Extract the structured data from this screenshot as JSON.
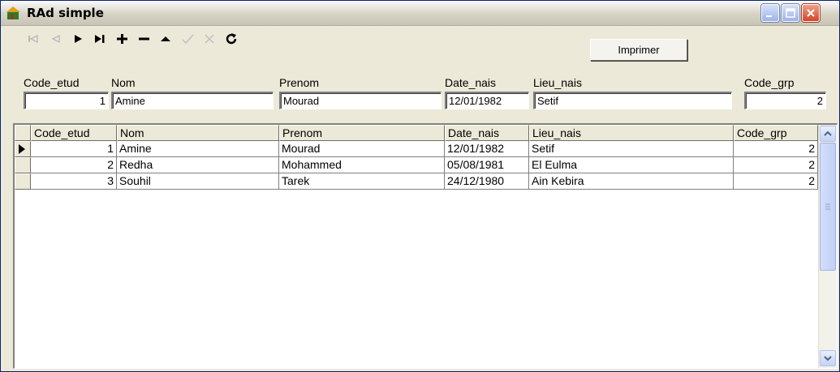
{
  "window": {
    "title": "RAd simple"
  },
  "navigator": {
    "buttons": [
      {
        "name": "first-record-icon",
        "enabled": false
      },
      {
        "name": "prior-record-icon",
        "enabled": false
      },
      {
        "name": "next-record-icon",
        "enabled": true
      },
      {
        "name": "last-record-icon",
        "enabled": true
      },
      {
        "name": "insert-record-icon",
        "enabled": true
      },
      {
        "name": "delete-record-icon",
        "enabled": true
      },
      {
        "name": "edit-record-icon",
        "enabled": true
      },
      {
        "name": "post-record-icon",
        "enabled": false
      },
      {
        "name": "cancel-record-icon",
        "enabled": false
      },
      {
        "name": "refresh-record-icon",
        "enabled": true
      }
    ]
  },
  "print_button": {
    "label": "Imprimer"
  },
  "form": {
    "code_etud": {
      "label": "Code_etud",
      "value": "1"
    },
    "nom": {
      "label": "Nom",
      "value": "Amine"
    },
    "prenom": {
      "label": "Prenom",
      "value": "Mourad"
    },
    "date_nais": {
      "label": "Date_nais",
      "value": "12/01/1982"
    },
    "lieu_nais": {
      "label": "Lieu_nais",
      "value": "Setif"
    },
    "code_grp": {
      "label": "Code_grp",
      "value": "2"
    }
  },
  "grid": {
    "columns": [
      "Code_etud",
      "Nom",
      "Prenom",
      "Date_nais",
      "Lieu_nais",
      "Code_grp"
    ],
    "rows": [
      [
        "1",
        "Amine",
        "Mourad",
        "12/01/1982",
        "Setif",
        "2"
      ],
      [
        "2",
        "Redha",
        "Mohammed",
        "05/08/1981",
        "El Eulma",
        "2"
      ],
      [
        "3",
        "Souhil",
        "Tarek",
        "24/12/1980",
        "Ain Kebira",
        "2"
      ]
    ],
    "current_row": 0
  },
  "colors": {
    "title_bar": "#d6d3c4",
    "window_bg": "#ece9d8",
    "close_button": "#d2452a"
  }
}
